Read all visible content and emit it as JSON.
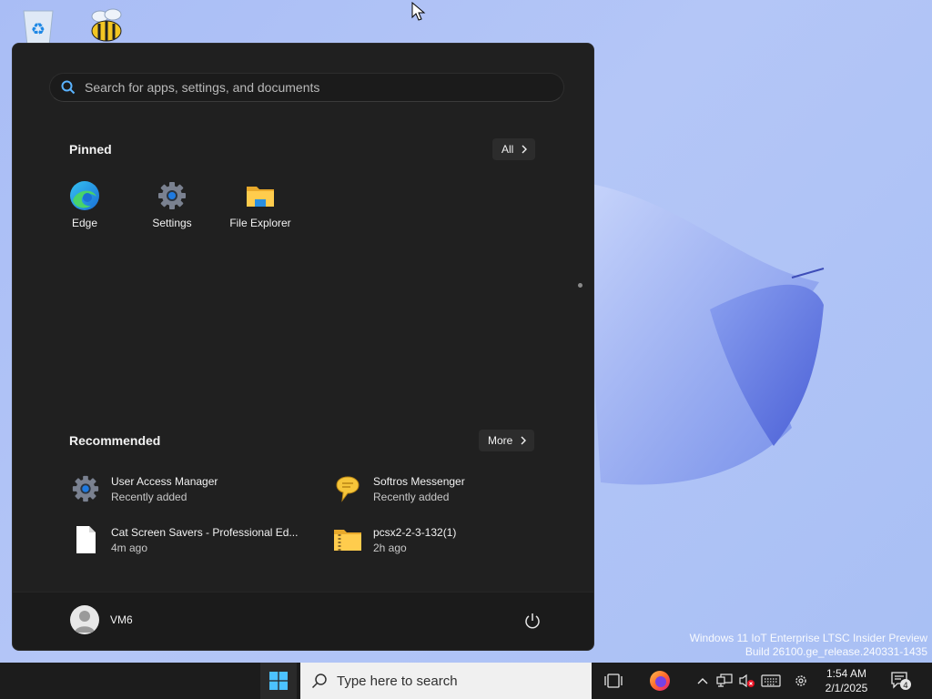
{
  "start_menu": {
    "search": {
      "placeholder": "Search for apps, settings, and documents",
      "value": ""
    },
    "pinned": {
      "title": "Pinned",
      "all_button": "All",
      "apps": [
        {
          "label": "Edge",
          "icon": "edge-icon"
        },
        {
          "label": "Settings",
          "icon": "settings-gear-icon"
        },
        {
          "label": "File Explorer",
          "icon": "folder-icon"
        }
      ]
    },
    "recommended": {
      "title": "Recommended",
      "more_button": "More",
      "items": [
        {
          "title": "User Access Manager",
          "subtitle": "Recently added",
          "icon": "gear-icon"
        },
        {
          "title": "Softros Messenger",
          "subtitle": "Recently added",
          "icon": "speech-bubble-icon"
        },
        {
          "title": "Cat Screen Savers - Professional Ed...",
          "subtitle": "4m ago",
          "icon": "document-icon"
        },
        {
          "title": "pcsx2-2-3-132(1)",
          "subtitle": "2h ago",
          "icon": "zip-folder-icon"
        }
      ]
    },
    "user": {
      "name": "VM6"
    }
  },
  "watermark": {
    "line1": "Windows 11 IoT Enterprise LTSC Insider Preview",
    "line2": "Build 26100.ge_release.240331-1435"
  },
  "taskbar": {
    "search_placeholder": "Type here to search",
    "clock": {
      "time": "1:54 AM",
      "date": "2/1/2025"
    },
    "notification_count": "4"
  },
  "colors": {
    "accent": "#0078d4",
    "menu_bg": "#202020",
    "taskbar_bg": "#1c1c1c"
  }
}
